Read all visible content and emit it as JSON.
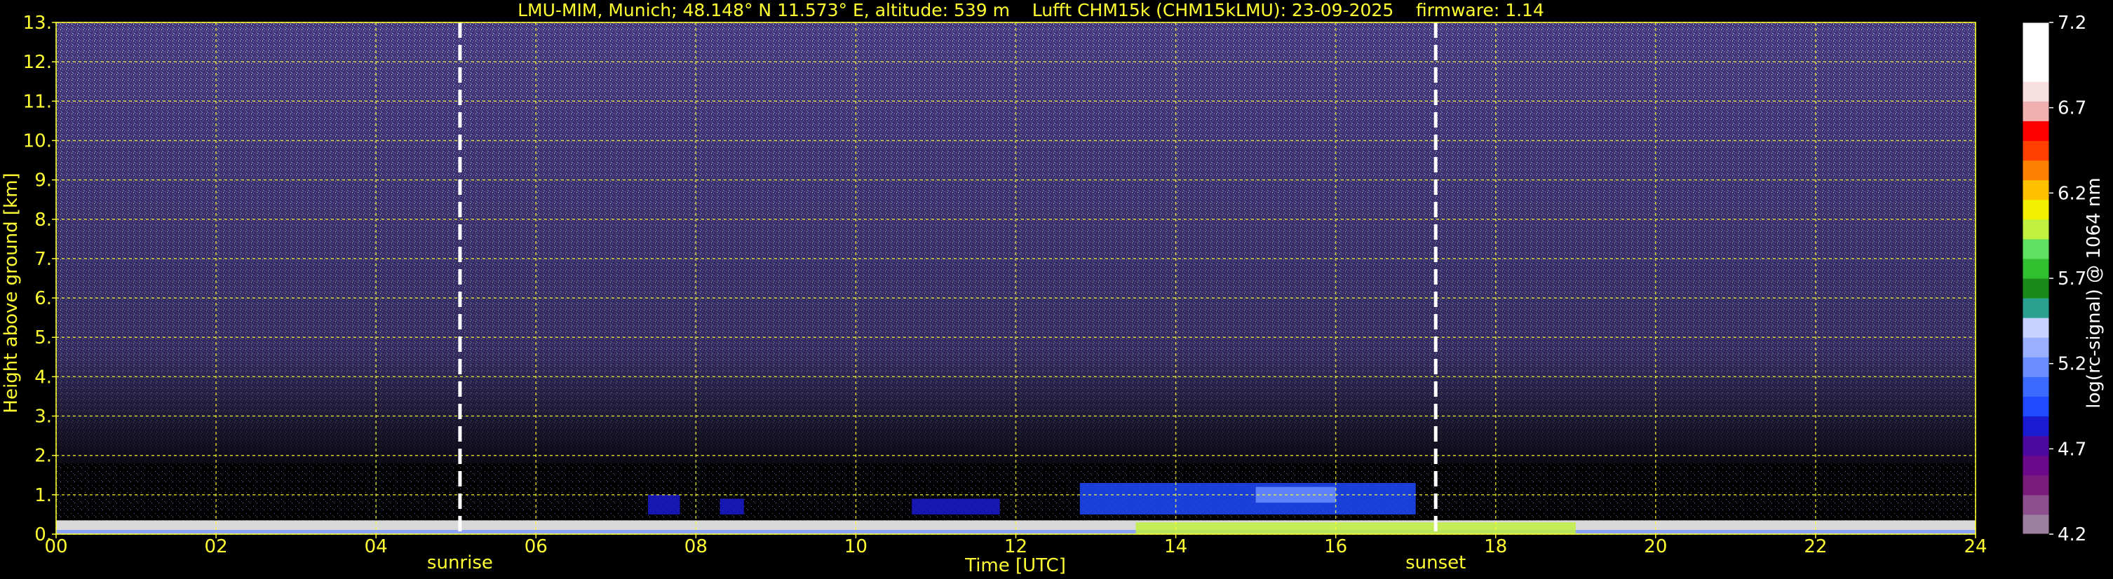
{
  "chart_data": {
    "type": "heatmap",
    "title": "LMU-MIM, Munich; 48.148° N 11.573° E, altitude: 539 m    Lufft CHM15k (CHM15kLMU): 23-09-2025    firmware: 1.14",
    "xlabel": "Time [UTC]",
    "ylabel": "Height above ground [km]",
    "xlim": [
      0,
      24
    ],
    "ylim": [
      0,
      13
    ],
    "x_ticks": [
      0,
      2,
      4,
      6,
      8,
      10,
      12,
      14,
      16,
      18,
      20,
      22,
      24
    ],
    "x_tick_labels": [
      "00",
      "02",
      "04",
      "06",
      "08",
      "10",
      "12",
      "14",
      "16",
      "18",
      "20",
      "22",
      "24"
    ],
    "y_ticks": [
      0,
      1,
      2,
      3,
      4,
      5,
      6,
      7,
      8,
      9,
      10,
      11,
      12,
      13
    ],
    "y_tick_labels": [
      "0.",
      "1.",
      "2.",
      "3.",
      "4.",
      "5.",
      "6.",
      "7.",
      "8.",
      "9.",
      "10.",
      "11.",
      "12.",
      "13."
    ],
    "grid": true,
    "sunrise": {
      "time": 5.05,
      "label": "sunrise"
    },
    "sunset": {
      "time": 17.25,
      "label": "sunset"
    },
    "colorbar": {
      "label": "log(rc-signal) @ 1064 nm",
      "range": [
        4.2,
        7.2
      ],
      "ticks": [
        4.2,
        4.7,
        5.2,
        5.7,
        6.2,
        6.7,
        7.2
      ],
      "tick_labels": [
        "4.2",
        "4.7",
        "5.2",
        "5.7",
        "6.2",
        "6.7",
        "7.2"
      ],
      "colors": [
        "#9d7fa0",
        "#8e4f8e",
        "#7a1a7a",
        "#6a0a8a",
        "#4a0aa0",
        "#1a1ad0",
        "#1f4aff",
        "#3a6aff",
        "#6a8eff",
        "#9ab0ff",
        "#c8d2ff",
        "#2aa090",
        "#1a8a1a",
        "#30c030",
        "#60e060",
        "#c0f040",
        "#f0f000",
        "#ffc000",
        "#ff8000",
        "#ff4000",
        "#ff0000",
        "#f0b0b0",
        "#f8e0e0",
        "#ffffff",
        "#ffffff",
        "#ffffff"
      ]
    },
    "features": [
      {
        "name": "noise background",
        "x_range": [
          0,
          24
        ],
        "y_range": [
          1.8,
          13
        ],
        "value": 4.5
      },
      {
        "name": "aerosol layer",
        "x_range": [
          7.4,
          7.8
        ],
        "y_range": [
          0.5,
          1.0
        ],
        "value": 4.8
      },
      {
        "name": "aerosol layer",
        "x_range": [
          8.3,
          8.6
        ],
        "y_range": [
          0.5,
          0.9
        ],
        "value": 4.8
      },
      {
        "name": "aerosol layer",
        "x_range": [
          10.7,
          11.8
        ],
        "y_range": [
          0.5,
          0.9
        ],
        "value": 4.8
      },
      {
        "name": "aerosol layer",
        "x_range": [
          12.8,
          17.0
        ],
        "y_range": [
          0.5,
          1.3
        ],
        "value": 4.9
      },
      {
        "name": "blue core",
        "x_range": [
          15.0,
          16.0
        ],
        "y_range": [
          0.8,
          1.2
        ],
        "value": 5.2
      },
      {
        "name": "surface layer",
        "x_range": [
          0,
          24
        ],
        "y_range": [
          0,
          0.35
        ],
        "value": 7.0
      },
      {
        "name": "boundary layer colored",
        "x_range": [
          13.5,
          19.0
        ],
        "y_range": [
          0,
          0.3
        ],
        "value": 6.0
      }
    ]
  },
  "colors": {
    "text": "#ffff33",
    "grid": "#ffff33",
    "background": "#000000",
    "marker": "#ffffff"
  }
}
